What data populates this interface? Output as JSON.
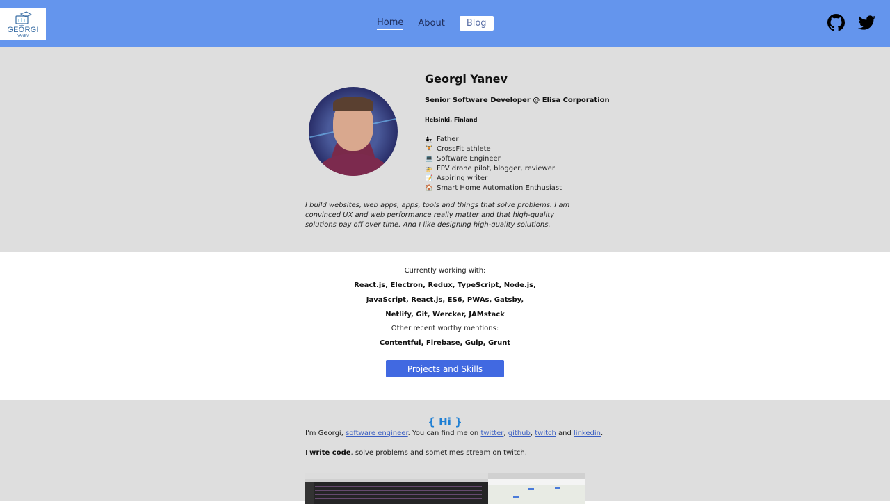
{
  "header": {
    "logo": {
      "title": "GEORGI",
      "subtitle": "YANEV",
      "icon": "graduation-cap-monitor-icon"
    },
    "nav": [
      {
        "label": "Home",
        "active": true
      },
      {
        "label": "About",
        "active": false
      },
      {
        "label": "Blog",
        "active": false,
        "highlighted": true
      }
    ],
    "social": [
      {
        "name": "github",
        "icon": "github-icon"
      },
      {
        "name": "twitter",
        "icon": "twitter-icon"
      }
    ],
    "background": "#6495ed"
  },
  "profile": {
    "name": "Georgi Yanev",
    "job": "Senior Software Developer @ Elisa Corporation",
    "location": "Helsinki, Finland",
    "traits": [
      {
        "emoji": "👨‍👧",
        "label": "Father"
      },
      {
        "emoji": "🏋",
        "label": "CrossFit athlete"
      },
      {
        "emoji": "💻",
        "label": "Software Engineer"
      },
      {
        "emoji": "🚁",
        "label": "FPV drone pilot, blogger, reviewer"
      },
      {
        "emoji": "📝",
        "label": "Aspiring writer"
      },
      {
        "emoji": "🏠",
        "label": "Smart Home Automation Enthusiast"
      }
    ],
    "bio": "I build websites, web apps, apps, tools and things that solve problems. I am convinced UX and web performance really matter and that high-quality solutions pay off over time. And I like designing high-quality solutions."
  },
  "skills": {
    "current_label": "Currently working with:",
    "current_lines": [
      "React.js, Electron, Redux, TypeScript, Node.js,",
      "JavaScript, React.js, ES6, PWAs, Gatsby,",
      "Netlify, Git, Wercker, JAMstack"
    ],
    "other_label": "Other recent worthy mentions:",
    "other_line": "Contentful, Firebase, Gulp, Grunt",
    "button_label": "Projects and Skills",
    "button_color": "#4169e1"
  },
  "hi": {
    "title": "{ Hi }",
    "title_color": "#1e7fd4",
    "intro_prefix": "I'm Georgi, ",
    "intro_link": "software engineer",
    "intro_mid": ". You can find me on ",
    "links": [
      "twitter",
      "github",
      "twitch"
    ],
    "sep1": ", ",
    "sep2": ", ",
    "and": " and ",
    "last_link": "linkedin",
    "end": ".",
    "p2_prefix": "I ",
    "p2_bold": "write code",
    "p2_suffix": ", solve problems and sometimes stream on twitch."
  }
}
